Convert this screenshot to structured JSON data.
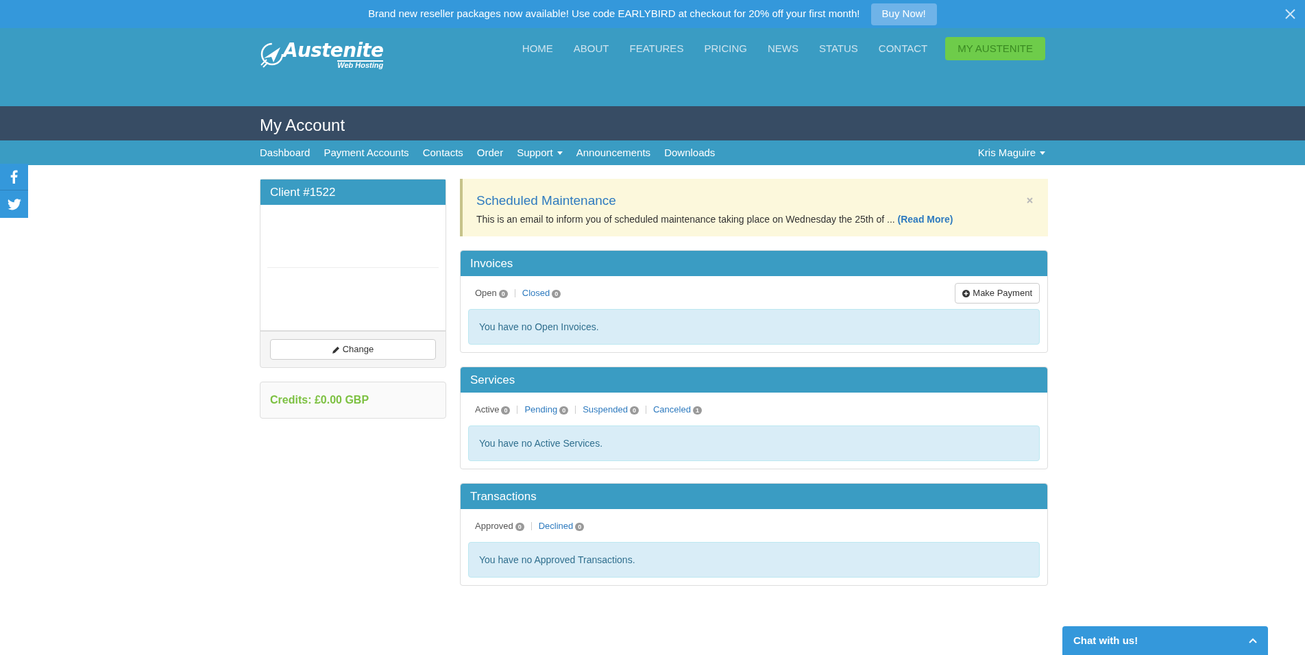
{
  "promo_bar": {
    "message": "Brand new reseller packages now available! Use code EARLYBIRD at checkout for 20% off your first month!",
    "button": "Buy Now!"
  },
  "logo": {
    "name": "Austenite",
    "tagline": "Web Hosting"
  },
  "main_nav": [
    {
      "label": "HOME",
      "kind": "link"
    },
    {
      "label": "ABOUT",
      "kind": "link"
    },
    {
      "label": "FEATURES",
      "kind": "link"
    },
    {
      "label": "PRICING",
      "kind": "link"
    },
    {
      "label": "NEWS",
      "kind": "link"
    },
    {
      "label": "STATUS",
      "kind": "link"
    },
    {
      "label": "CONTACT",
      "kind": "link"
    },
    {
      "label": "MY AUSTENITE",
      "kind": "button"
    }
  ],
  "page_title": "My Account",
  "account_nav": [
    {
      "label": "Dashboard",
      "dropdown": false
    },
    {
      "label": "Payment Accounts",
      "dropdown": false
    },
    {
      "label": "Contacts",
      "dropdown": false
    },
    {
      "label": "Order",
      "dropdown": false
    },
    {
      "label": "Support",
      "dropdown": true
    },
    {
      "label": "Announcements",
      "dropdown": false
    },
    {
      "label": "Downloads",
      "dropdown": false
    }
  ],
  "user_menu": "Kris Maguire",
  "client_card": {
    "title": "Client #1522",
    "button": "Change"
  },
  "credits": "Credits: £0.00 GBP",
  "announcement": {
    "title": "Scheduled Maintenance",
    "text": "This is an email to inform you of scheduled maintenance taking place on Wednesday the 25th of ...",
    "link": "(Read More)"
  },
  "panels": [
    {
      "title": "Invoices",
      "tabs": [
        {
          "label": "Open",
          "count": "0",
          "selected": true
        },
        {
          "label": "Closed",
          "count": "0",
          "selected": false
        }
      ],
      "action": "Make Payment",
      "message": "You have no Open Invoices."
    },
    {
      "title": "Services",
      "tabs": [
        {
          "label": "Active",
          "count": "0",
          "selected": true
        },
        {
          "label": "Pending",
          "count": "0",
          "selected": false
        },
        {
          "label": "Suspended",
          "count": "0",
          "selected": false
        },
        {
          "label": "Canceled",
          "count": "1",
          "selected": false
        }
      ],
      "message": "You have no Active Services."
    },
    {
      "title": "Transactions",
      "tabs": [
        {
          "label": "Approved",
          "count": "0",
          "selected": true
        },
        {
          "label": "Declined",
          "count": "0",
          "selected": false
        }
      ],
      "message": "You have no Approved Transactions."
    }
  ],
  "chat": {
    "label": "Chat with us!"
  }
}
